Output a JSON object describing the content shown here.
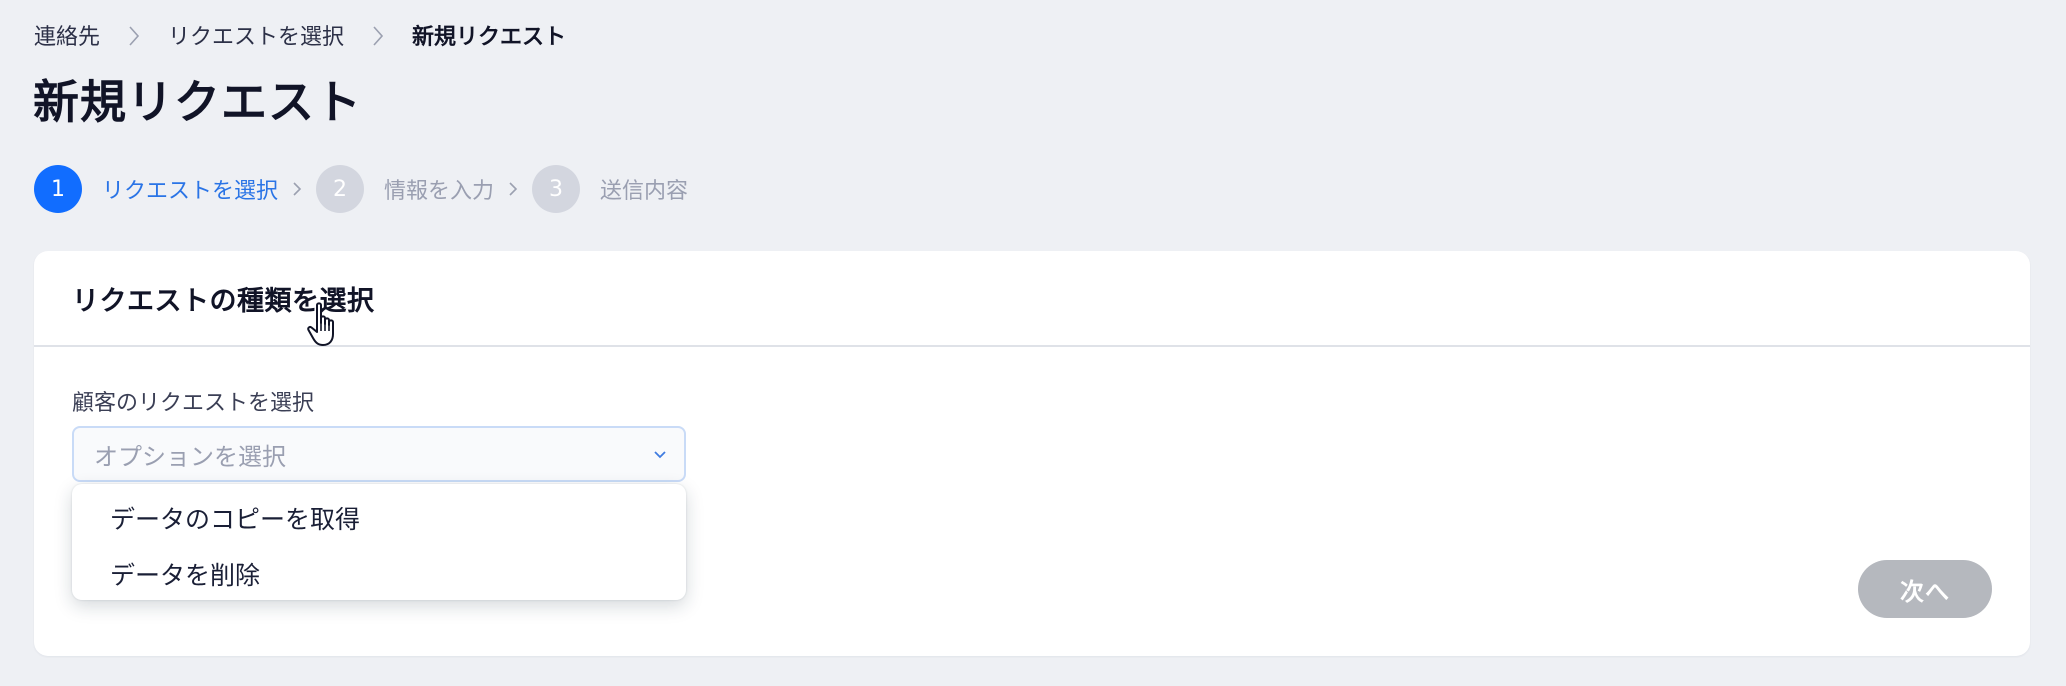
{
  "breadcrumb": {
    "items": [
      "連絡先",
      "リクエストを選択",
      "新規リクエスト"
    ]
  },
  "page": {
    "title": "新規リクエスト"
  },
  "stepper": {
    "steps": [
      {
        "number": "1",
        "label": "リクエストを選択",
        "active": true
      },
      {
        "number": "2",
        "label": "情報を入力",
        "active": false
      },
      {
        "number": "3",
        "label": "送信内容",
        "active": false
      }
    ]
  },
  "card": {
    "title": "リクエストの種類を選択",
    "field_label": "顧客のリクエストを選択",
    "select": {
      "placeholder": "オプションを選択",
      "options": [
        "データのコピーを取得",
        "データを削除"
      ]
    },
    "next_label": "次へ"
  },
  "colors": {
    "accent": "#116dff",
    "background": "#eef0f4",
    "disabled_button": "#b5b8be"
  },
  "icons": [
    "chevron-right-icon",
    "chevron-down-icon",
    "hand-pointer-cursor-icon"
  ]
}
